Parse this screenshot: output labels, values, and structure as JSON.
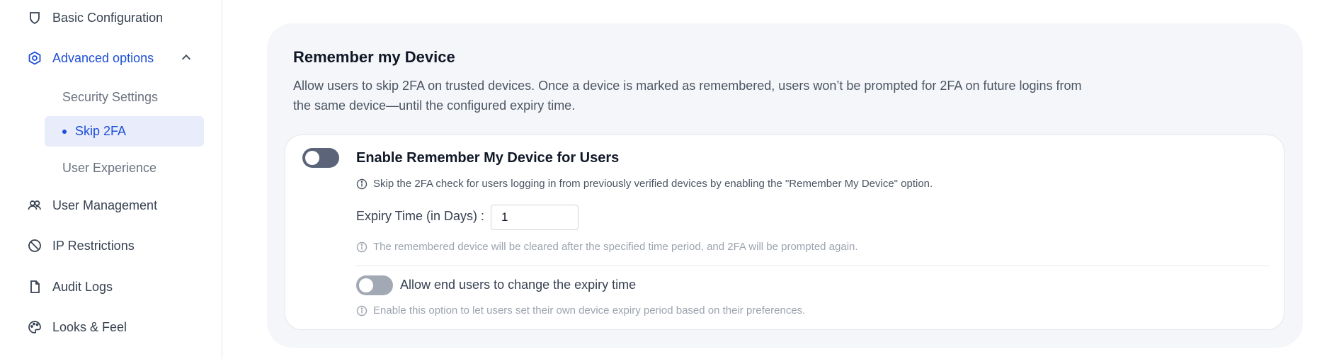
{
  "sidebar": {
    "items": [
      {
        "label": "Basic Configuration",
        "icon": "shield-icon"
      },
      {
        "label": "Advanced options",
        "icon": "settings-hex-icon",
        "active": true
      },
      {
        "label": "User Management",
        "icon": "users-icon"
      },
      {
        "label": "IP Restrictions",
        "icon": "ban-icon"
      },
      {
        "label": "Audit Logs",
        "icon": "file-icon"
      },
      {
        "label": "Looks & Feel",
        "icon": "palette-icon"
      }
    ],
    "submenu": [
      {
        "label": "Security Settings"
      },
      {
        "label": "Skip 2FA",
        "active": true
      },
      {
        "label": "User Experience"
      }
    ]
  },
  "section": {
    "title": "Remember my Device",
    "description": "Allow users to skip 2FA on trusted devices. Once a device is marked as remembered, users won’t be prompted for 2FA on future logins from the same device—until the configured expiry time."
  },
  "option": {
    "title": "Enable Remember My Device for Users",
    "hint": "Skip the 2FA check for users logging in from previously verified devices by enabling the \"Remember My Device\" option.",
    "enabled": false,
    "expiry_label": "Expiry Time (in Days) :",
    "expiry_value": "1",
    "expiry_hint": "The remembered device will be cleared after the specified time period, and 2FA will be prompted again.",
    "allow_label": "Allow end users to change the expiry time",
    "allow_enabled": false,
    "allow_hint": "Enable this option to let users set their own device expiry period based on their preferences."
  },
  "colors": {
    "accent": "#1d4ed8",
    "active_bg": "#e8ecfb",
    "toggle_dark": "#5b6478",
    "toggle_light": "#a3a9b4"
  }
}
